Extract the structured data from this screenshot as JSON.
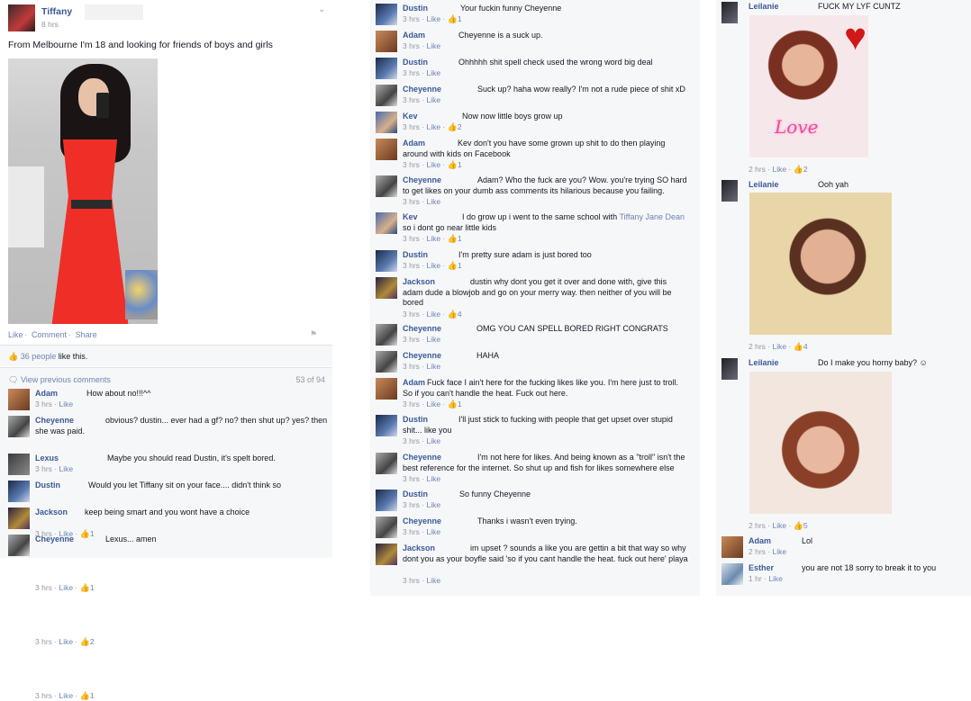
{
  "post": {
    "author": "Tiffany",
    "time": "8 hrs",
    "text": "From Melbourne I'm 18 and looking for friends of boys and girls",
    "actions": [
      "Like",
      "Comment",
      "Share"
    ],
    "likes_count": "36 people",
    "likes_suffix": "like this.",
    "view_previous": "View previous comments",
    "comment_count": "53 of 94"
  },
  "left_comments": [
    {
      "name": "Adam",
      "text": "How about no!!!^^",
      "time": "3 hrs",
      "like": "Like",
      "likes": "",
      "avatar": "av-a"
    },
    {
      "name": "Cheyenne",
      "text": "obvious? dustin... ever had a gf? no? then shut up? yes? then she was paid.",
      "time": "3 hrs",
      "like": "Like",
      "likes": "",
      "avatar": "av-c"
    },
    {
      "name": "Lexus",
      "text": "Maybe you should read Dustin, it's spelt bored.",
      "time": "3 hrs",
      "like": "Like",
      "likes": "1",
      "avatar": "av-l"
    },
    {
      "name": "Dustin",
      "text": "Would you let Tiffany sit on your face.... didn't think so",
      "time": "3 hrs",
      "like": "Like",
      "likes": "1",
      "avatar": "av-d"
    },
    {
      "name": "Jackson",
      "text": "keep being smart and you wont have a choice",
      "time": "3 hrs",
      "like": "Like",
      "likes": "2",
      "avatar": "av-j"
    },
    {
      "name": "Cheyenne",
      "text": "Lexus... amen",
      "time": "3 hrs",
      "like": "Like",
      "likes": "1",
      "avatar": "av-c"
    }
  ],
  "mid_comments": [
    {
      "name": "Dustin",
      "text": "Your fuckin funny Cheyenne",
      "time": "3 hrs",
      "like": "Like",
      "likes": "1",
      "avatar": "av-d"
    },
    {
      "name": "Adam",
      "text": "Cheyenne is a suck up.",
      "time": "3 hrs",
      "like": "Like",
      "likes": "",
      "avatar": "av-a"
    },
    {
      "name": "Dustin",
      "text": "Ohhhhh shit spell check used the wrong word big deal",
      "time": "3 hrs",
      "like": "Like",
      "likes": "",
      "avatar": "av-d"
    },
    {
      "name": "Cheyenne",
      "text": "Suck up? haha wow really? I'm not a rude piece of shit xD",
      "time": "3 hrs",
      "like": "Like",
      "likes": "",
      "avatar": "av-c"
    },
    {
      "name": "Kev",
      "text": "Now now little boys grow up",
      "time": "3 hrs",
      "like": "Like",
      "likes": "2",
      "avatar": "av-k"
    },
    {
      "name": "Adam",
      "text": "Kev don't you have some grown up shit to do then playing around with kids on Facebook",
      "time": "3 hrs",
      "like": "Like",
      "likes": "1",
      "avatar": "av-a"
    },
    {
      "name": "Cheyenne",
      "text": "Adam? Who the fuck are you? Wow. you're trying SO hard to get likes on your dumb ass comments its hilarious because you failing.",
      "time": "3 hrs",
      "like": "Like",
      "likes": "",
      "avatar": "av-c"
    },
    {
      "name": "Kev",
      "text": "I do grow up i went to the same school with",
      "mention": "Tiffany Jane Dean",
      "text2": "so i dont go near little kids",
      "time": "3 hrs",
      "like": "Like",
      "likes": "1",
      "avatar": "av-k"
    },
    {
      "name": "Dustin",
      "text": "I'm pretty sure adam is just bored too",
      "time": "3 hrs",
      "like": "Like",
      "likes": "1",
      "avatar": "av-d"
    },
    {
      "name": "Jackson",
      "text": "dustin why dont you get it over and done with, give this adam dude a blowjob and go on your merry way. then neither of you will be bored",
      "time": "3 hrs",
      "like": "Like",
      "likes": "4",
      "avatar": "av-j"
    },
    {
      "name": "Cheyenne",
      "text": "OMG YOU CAN SPELL BORED RIGHT CONGRATS",
      "time": "3 hrs",
      "like": "Like",
      "likes": "",
      "avatar": "av-c"
    },
    {
      "name": "Cheyenne",
      "text": "HAHA",
      "time": "3 hrs",
      "like": "Like",
      "likes": "",
      "avatar": "av-c"
    },
    {
      "name": "Adam",
      "text": "Fuck face I ain't here for the fucking likes like you. I'm here just to troll. So if you can't handle the heat. Fuck out here.",
      "time": "3 hrs",
      "like": "Like",
      "likes": "1",
      "avatar": "av-a"
    },
    {
      "name": "Dustin",
      "text": "I'll just stick to fucking with people that get upset over stupid shit... like you",
      "time": "3 hrs",
      "like": "Like",
      "likes": "",
      "avatar": "av-d"
    },
    {
      "name": "Cheyenne",
      "text": "I'm not here for likes. And being known as a \"troll\" isn't the best reference for the internet. So shut up and fish for likes somewhere else",
      "time": "3 hrs",
      "like": "Like",
      "likes": "",
      "avatar": "av-c"
    },
    {
      "name": "Dustin",
      "text": "So funny Cheyenne",
      "time": "3 hrs",
      "like": "Like",
      "likes": "",
      "avatar": "av-d"
    },
    {
      "name": "Cheyenne",
      "text": "Thanks i wasn't even trying.",
      "time": "3 hrs",
      "like": "Like",
      "likes": "",
      "avatar": "av-c"
    },
    {
      "name": "Jackson",
      "text": "im upset ? sounds a like you are gettin a bit that way so why dont you as your boyfle said 'so if you cant handle the heat. fuck out here' playa",
      "time": "3 hrs",
      "like": "Like",
      "likes": "",
      "avatar": "av-j"
    }
  ],
  "right_comments": [
    {
      "name": "Leilanie",
      "text": "FUCK MY LYF CUNTZ",
      "time": "2 hrs",
      "like": "Like",
      "likes": "2",
      "avatar": "av-le",
      "image_text": "Love"
    },
    {
      "name": "Leilanie",
      "text": "Ooh yah",
      "time": "2 hrs",
      "like": "Like",
      "likes": "4",
      "avatar": "av-le"
    },
    {
      "name": "Leilanie",
      "text": "Do I make you horny baby? ☺",
      "time": "2 hrs",
      "like": "Like",
      "likes": "5",
      "avatar": "av-le"
    },
    {
      "name": "Adam",
      "text": "Lol",
      "time": "2 hrs",
      "like": "Like",
      "likes": "",
      "avatar": "av-a"
    },
    {
      "name": "Esther",
      "text": "you are not 18 sorry to break it to you",
      "time": "1 hr",
      "like": "Like",
      "likes": "",
      "avatar": "av-e"
    }
  ]
}
